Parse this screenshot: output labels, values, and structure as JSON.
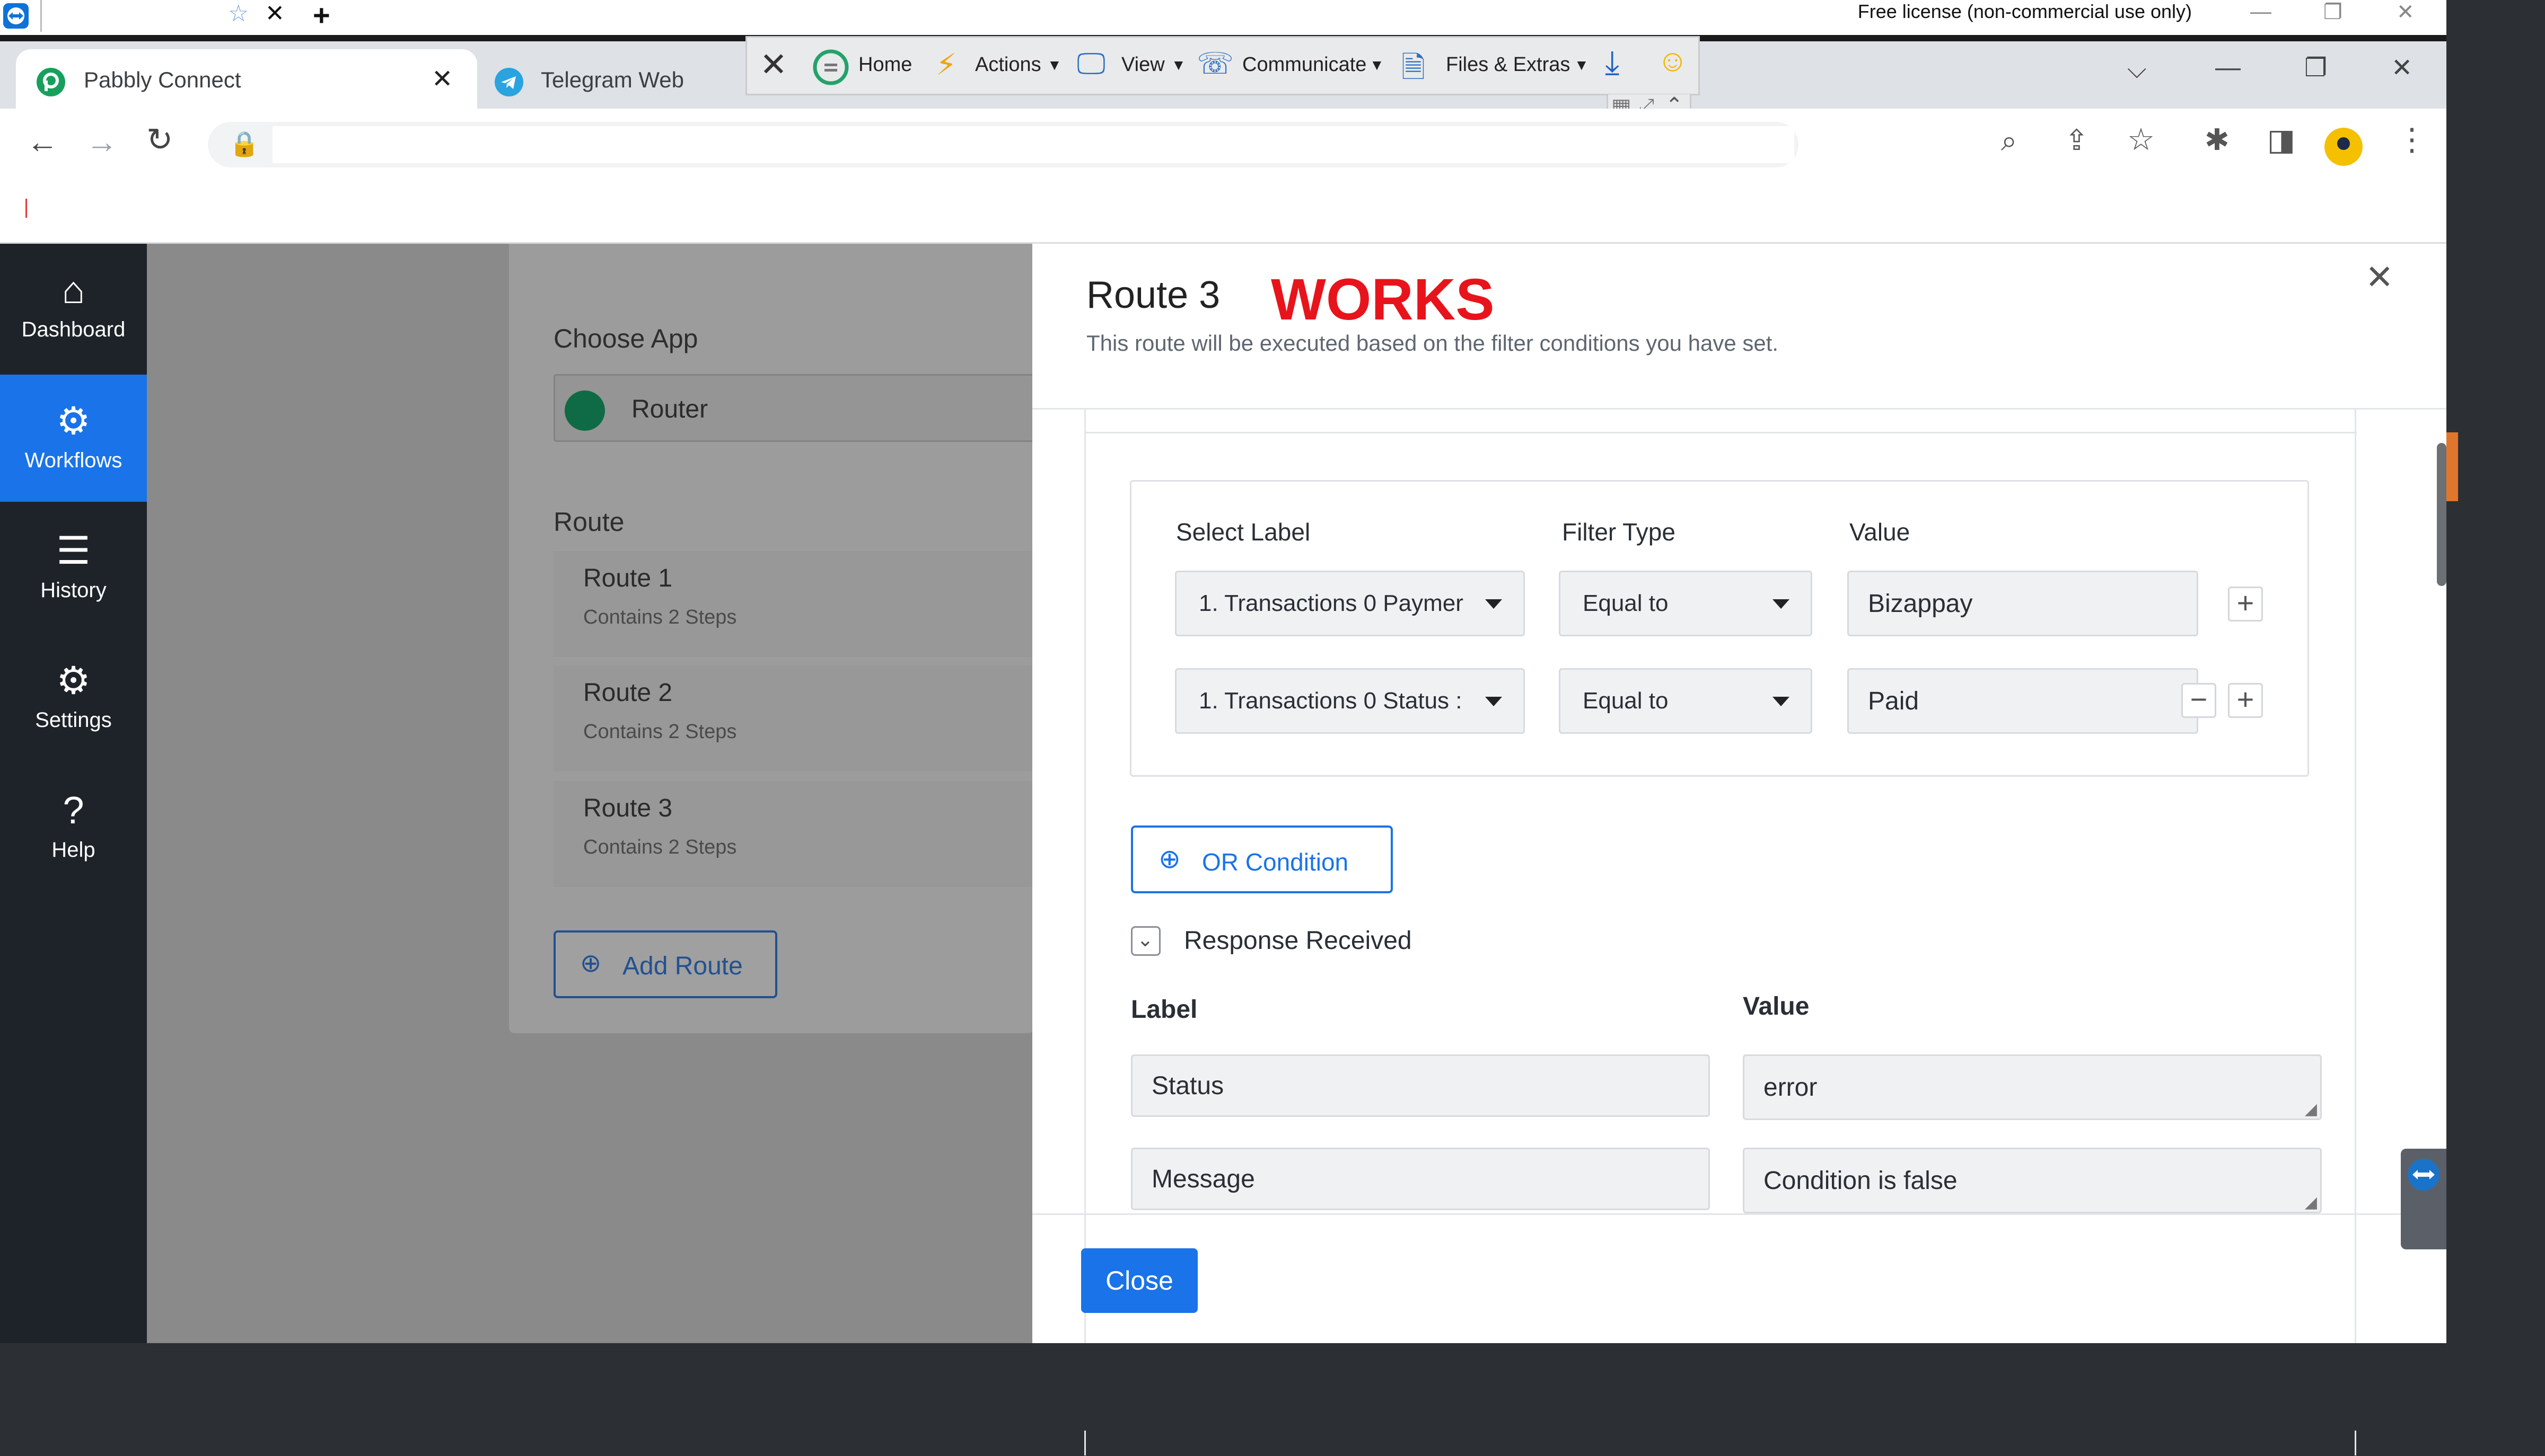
{
  "teamviewer": {
    "license_text": "Free license (non-commercial use only)",
    "toolbar": {
      "home": "Home",
      "actions": "Actions",
      "view": "View",
      "communicate": "Communicate",
      "files_extras": "Files & Extras"
    }
  },
  "browser": {
    "tabs": [
      {
        "label": "Pabbly Connect"
      },
      {
        "label": "Telegram Web"
      }
    ],
    "address": ""
  },
  "sidebar": {
    "items": [
      {
        "label": "Dashboard"
      },
      {
        "label": "Workflows"
      },
      {
        "label": "History"
      },
      {
        "label": "Settings"
      },
      {
        "label": "Help"
      }
    ]
  },
  "background_panel": {
    "choose_app_label": "Choose App",
    "app_name": "Router",
    "route_heading": "Route",
    "routes": [
      {
        "name": "Route 1",
        "steps": "Contains 2 Steps"
      },
      {
        "name": "Route 2",
        "steps": "Contains 2 Steps"
      },
      {
        "name": "Route 3",
        "steps": "Contains 2 Steps"
      }
    ],
    "add_route_label": "Add Route"
  },
  "modal": {
    "title": "Route 3",
    "annotation": "WORKS",
    "subtitle": "This route will be executed based on the filter conditions you have set.",
    "filter_headers": {
      "label": "Select Label",
      "type": "Filter Type",
      "value": "Value"
    },
    "filters": [
      {
        "label": "1. Transactions 0 Paymer",
        "type": "Equal to",
        "value": "Bizappay"
      },
      {
        "label": "1. Transactions 0 Status :",
        "type": "Equal to",
        "value": "Paid"
      }
    ],
    "or_condition_label": "OR Condition",
    "response_received_label": "Response Received",
    "response_headers": {
      "label": "Label",
      "value": "Value"
    },
    "responses": [
      {
        "label": "Status",
        "value": "error"
      },
      {
        "label": "Message",
        "value": "Condition is false"
      }
    ],
    "close_button": "Close"
  },
  "colors": {
    "accent": "#1a73e8",
    "annotation": "#e8141b",
    "sidebar_bg": "#1e2329"
  }
}
